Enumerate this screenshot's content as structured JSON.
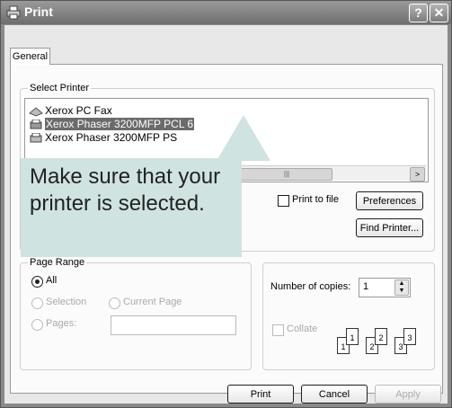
{
  "window": {
    "title": "Print",
    "help_btn": "?",
    "close_btn": "✕"
  },
  "tabs": [
    {
      "label": "General"
    }
  ],
  "select_printer": {
    "label": "Select Printer",
    "printers": [
      {
        "name": "Xerox PC Fax",
        "icon": "fax-icon"
      },
      {
        "name": "Xerox Phaser 3200MFP PCL 6",
        "icon": "printer-icon",
        "selected": true
      },
      {
        "name": "Xerox Phaser 3200MFP PS",
        "icon": "printer-icon"
      }
    ],
    "print_to_file": "Print to file",
    "preferences": "Preferences",
    "find_printer": "Find Printer..."
  },
  "callout": {
    "text": "Make sure that your printer is selected."
  },
  "page_range": {
    "label": "Page Range",
    "all": "All",
    "selection": "Selection",
    "current_page": "Current Page",
    "pages": "Pages:"
  },
  "copies": {
    "label": "Number of copies:",
    "value": "1",
    "collate": "Collate",
    "sheets": [
      "1",
      "1",
      "2",
      "2",
      "3",
      "3"
    ]
  },
  "footer": {
    "print": "Print",
    "cancel": "Cancel",
    "apply": "Apply"
  }
}
